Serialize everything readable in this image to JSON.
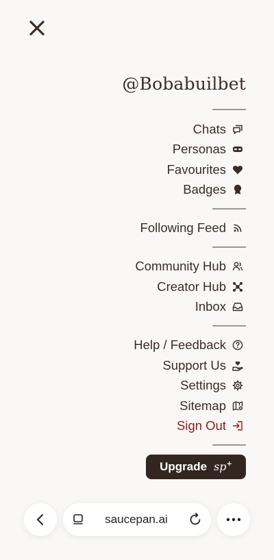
{
  "username": "@Bobabuilbet",
  "menu": {
    "group1": [
      {
        "label": "Chats",
        "icon": "chat-bubbles-icon"
      },
      {
        "label": "Personas",
        "icon": "mask-icon"
      },
      {
        "label": "Favourites",
        "icon": "heart-icon"
      },
      {
        "label": "Badges",
        "icon": "badge-icon"
      }
    ],
    "group2": [
      {
        "label": "Following Feed",
        "icon": "rss-icon"
      }
    ],
    "group3": [
      {
        "label": "Community Hub",
        "icon": "users-icon"
      },
      {
        "label": "Creator Hub",
        "icon": "hub-icon"
      },
      {
        "label": "Inbox",
        "icon": "inbox-icon"
      }
    ],
    "group4": [
      {
        "label": "Help / Feedback",
        "icon": "help-icon"
      },
      {
        "label": "Support Us",
        "icon": "hand-heart-icon"
      },
      {
        "label": "Settings",
        "icon": "gear-icon"
      },
      {
        "label": "Sitemap",
        "icon": "map-icon"
      },
      {
        "label": "Sign Out",
        "icon": "sign-out-icon"
      }
    ]
  },
  "upgrade": {
    "label": "Upgrade",
    "logo": "sp",
    "logo_sup": "+"
  },
  "browser": {
    "url": "saucepan.ai"
  },
  "colors": {
    "text": "#3a2c27",
    "danger": "#8e1a1a",
    "button_bg": "#332621",
    "background": "#faf8f6"
  }
}
